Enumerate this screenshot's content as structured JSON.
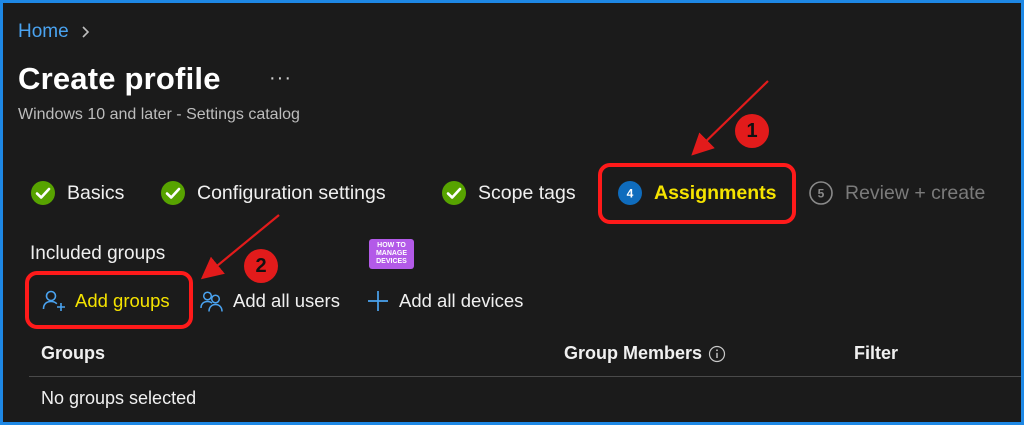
{
  "breadcrumb": {
    "home": "Home"
  },
  "page": {
    "title": "Create profile",
    "more": "···",
    "subtitle": "Windows 10 and later - Settings catalog"
  },
  "steps": [
    {
      "label": "Basics",
      "state": "complete"
    },
    {
      "label": "Configuration settings",
      "state": "complete"
    },
    {
      "label": "Scope tags",
      "state": "complete"
    },
    {
      "label": "Assignments",
      "state": "current",
      "number": "4"
    },
    {
      "label": "Review + create",
      "state": "upcoming",
      "number": "5"
    }
  ],
  "included_groups": {
    "label": "Included groups",
    "actions": {
      "add_groups": "Add groups",
      "add_all_users": "Add all users",
      "add_all_devices": "Add all devices"
    }
  },
  "table": {
    "columns": [
      "Groups",
      "Group Members",
      "Filter"
    ],
    "empty_text": "No groups selected"
  },
  "annotations": {
    "badge_1": "1",
    "badge_2": "2"
  },
  "logo": {
    "lines": [
      "HOW TO",
      "MANAGE",
      "DEVICES"
    ]
  },
  "colors": {
    "background": "#1b1b1b",
    "link": "#4aa3f0",
    "complete": "#57a300",
    "current": "#0f6cbd",
    "highlight_text": "#f5e300",
    "annotation": "#e21b1b",
    "frame": "#1e88e5"
  }
}
